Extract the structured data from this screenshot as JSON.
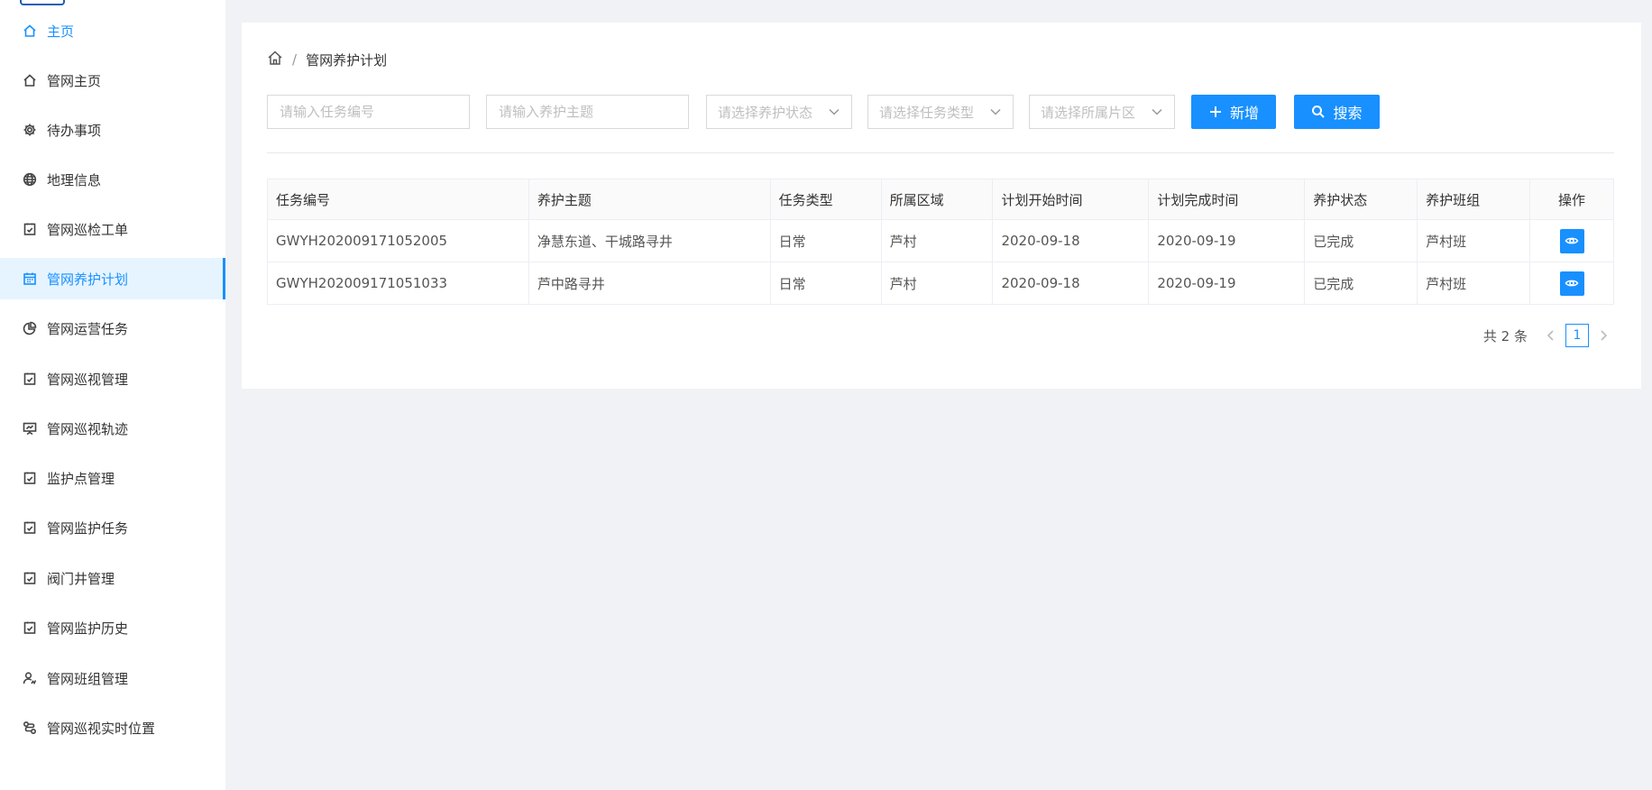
{
  "sidebar": {
    "items": [
      {
        "label": "主页",
        "icon": "home-icon"
      },
      {
        "label": "管网主页",
        "icon": "home-icon"
      },
      {
        "label": "待办事项",
        "icon": "gear-icon"
      },
      {
        "label": "地理信息",
        "icon": "globe-icon"
      },
      {
        "label": "管网巡检工单",
        "icon": "checklist-icon"
      },
      {
        "label": "管网养护计划",
        "icon": "calendar-icon"
      },
      {
        "label": "管网运营任务",
        "icon": "pie-chart-icon"
      },
      {
        "label": "管网巡视管理",
        "icon": "checklist-icon"
      },
      {
        "label": "管网巡视轨迹",
        "icon": "presentation-icon"
      },
      {
        "label": "监护点管理",
        "icon": "checklist-icon"
      },
      {
        "label": "管网监护任务",
        "icon": "checklist-icon"
      },
      {
        "label": "阀门井管理",
        "icon": "checklist-icon"
      },
      {
        "label": "管网监护历史",
        "icon": "checklist-icon"
      },
      {
        "label": "管网班组管理",
        "icon": "team-icon"
      },
      {
        "label": "管网巡视实时位置",
        "icon": "route-icon"
      }
    ],
    "active_color": "#1890ff"
  },
  "breadcrumb": {
    "current": "管网养护计划",
    "separator": "/"
  },
  "filters": {
    "task_no_placeholder": "请输入任务编号",
    "subject_placeholder": "请输入养护主题",
    "status_placeholder": "请选择养护状态",
    "type_placeholder": "请选择任务类型",
    "area_placeholder": "请选择所属片区",
    "add_label": "新增",
    "search_label": "搜索"
  },
  "table": {
    "headers": [
      "任务编号",
      "养护主题",
      "任务类型",
      "所属区域",
      "计划开始时间",
      "计划完成时间",
      "养护状态",
      "养护班组",
      "操作"
    ],
    "rows": [
      [
        "GWYH202009171052005",
        "净慧东道、干城路寻井",
        "日常",
        "芦村",
        "2020-09-18",
        "2020-09-19",
        "已完成",
        "芦村班"
      ],
      [
        "GWYH202009171051033",
        "芦中路寻井",
        "日常",
        "芦村",
        "2020-09-18",
        "2020-09-19",
        "已完成",
        "芦村班"
      ]
    ]
  },
  "pagination": {
    "total_text": "共 2 条",
    "current_page": "1"
  },
  "colors": {
    "primary": "#1890ff",
    "background": "#f0f2f5"
  }
}
